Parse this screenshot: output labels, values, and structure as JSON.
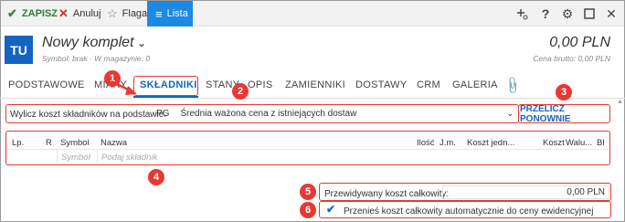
{
  "toolbar": {
    "save": "ZAPISZ",
    "cancel": "Anuluj",
    "flag": "Flaga",
    "list": "Lista",
    "icons": [
      "add-icon",
      "help-icon",
      "gear-icon",
      "maximize-icon",
      "close-icon"
    ]
  },
  "header": {
    "avatar": "TU",
    "title": "Nowy komplet",
    "subtitle": "Symbol: brak  ·  W magazynie: 0",
    "price": "0,00 PLN",
    "price_sub": "Cena brutto: 0,00 PLN"
  },
  "tabs": [
    {
      "label": "PODSTAWOWE"
    },
    {
      "label": "MIARY"
    },
    {
      "label": "SKŁADNIKI"
    },
    {
      "label": "STANY"
    },
    {
      "label": "OPIS"
    },
    {
      "label": "ZAMIENNIKI"
    },
    {
      "label": "DOSTAWY"
    },
    {
      "label": "CRM"
    },
    {
      "label": "GALERIA"
    }
  ],
  "components": {
    "calc_label": "Wylicz koszt składników na podstawie:",
    "calc_code": "PG",
    "calc_value": "Średnia ważona cena z istniejących dostaw",
    "recalc_button": "PRZELICZ PONOWNIE",
    "grid_headers": [
      "Lp.",
      "R",
      "Symbol",
      "Nazwa",
      "Ilość",
      "J.m.",
      "Koszt jedn...",
      "Koszt",
      "Walu...",
      "Bl"
    ],
    "row_symbol_placeholder": "Symbol",
    "row_name_placeholder": "Podaj składnik",
    "cost_label": "Przewidywany koszt całkowity:",
    "cost_value": "0,00 PLN",
    "transfer_label": "Przenieś koszt całkowity automatycznie do ceny ewidencyjnej"
  },
  "badges": [
    "1",
    "2",
    "3",
    "4",
    "5",
    "6"
  ],
  "colors": {
    "accent": "#1565c0",
    "list_button": "#1e88e5",
    "highlight": "#e53935",
    "save": "#2e7d32"
  }
}
